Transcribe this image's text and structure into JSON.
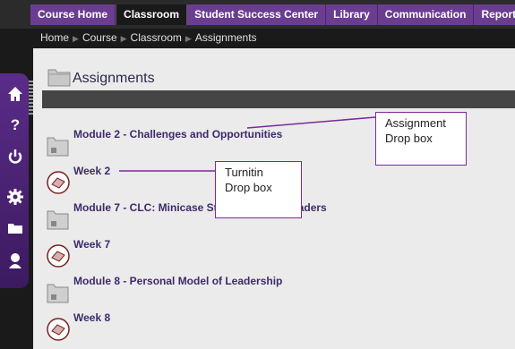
{
  "topnav": {
    "tabs": [
      {
        "label": "Course Home",
        "active": false
      },
      {
        "label": "Classroom",
        "active": true
      },
      {
        "label": "Student Success Center",
        "active": false
      },
      {
        "label": "Library",
        "active": false
      },
      {
        "label": "Communication",
        "active": false
      },
      {
        "label": "Reports",
        "active": false
      }
    ]
  },
  "sidebar": {
    "buttons": [
      "home-icon",
      "help-icon",
      "power-icon",
      "settings-icon",
      "folder-icon",
      "user-icon"
    ],
    "help_glyph": "?"
  },
  "breadcrumb": [
    "Home",
    "Course",
    "Classroom",
    "Assignments"
  ],
  "page": {
    "title": "Assignments"
  },
  "items": [
    {
      "label": "Module 2 - Challenges and Opportunities",
      "icon": "folder-icon"
    },
    {
      "label": "Week 2",
      "icon": "turnitin-icon"
    },
    {
      "label": "Module 7 - CLC: Minicase Study: Servant Leaders",
      "icon": "folder-icon"
    },
    {
      "label": "Week 7",
      "icon": "turnitin-icon"
    },
    {
      "label": "Module 8 - Personal Model of Leadership",
      "icon": "folder-icon"
    },
    {
      "label": "Week 8",
      "icon": "turnitin-icon"
    }
  ],
  "annotations": {
    "assignment_line1": "Assignment",
    "assignment_line2": "Drop box",
    "turnitin_line1": "Turnitin",
    "turnitin_line2": "Drop box"
  },
  "colors": {
    "nav_purple": "#6a3d91",
    "link": "#3d2a6b",
    "callout_border": "#7a2a9a"
  }
}
